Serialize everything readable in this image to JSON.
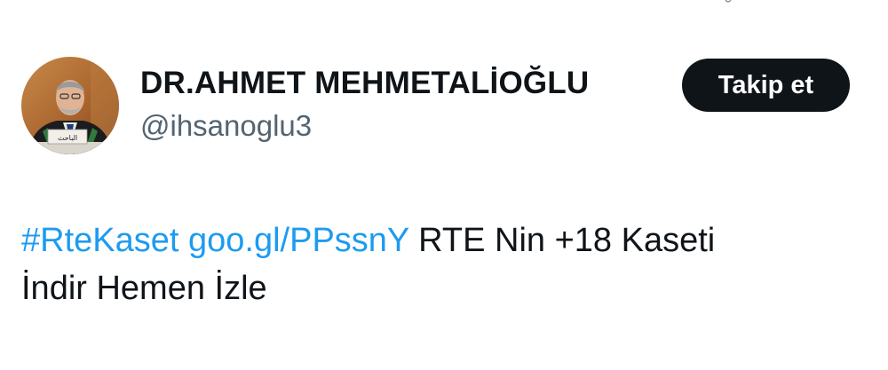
{
  "tweet": {
    "author": {
      "display_name": "DR.AHMET MEHMETALİOĞLU",
      "handle": "@ihsanoglu3",
      "avatar_placard_text": "الباحث"
    },
    "follow_button_label": "Takip et",
    "hashtag": "#RteKaset",
    "link": "goo.gl/PPssnY",
    "text_line1": "RTE Nin +18 Kaseti",
    "text_line2": "İndir Hemen İzle"
  },
  "colors": {
    "text_primary": "#0f1419",
    "text_secondary": "#536471",
    "link": "#1d9bf0",
    "button_bg": "#0f1419",
    "button_text": "#ffffff"
  },
  "icons": {
    "avatar": "user-photo"
  }
}
